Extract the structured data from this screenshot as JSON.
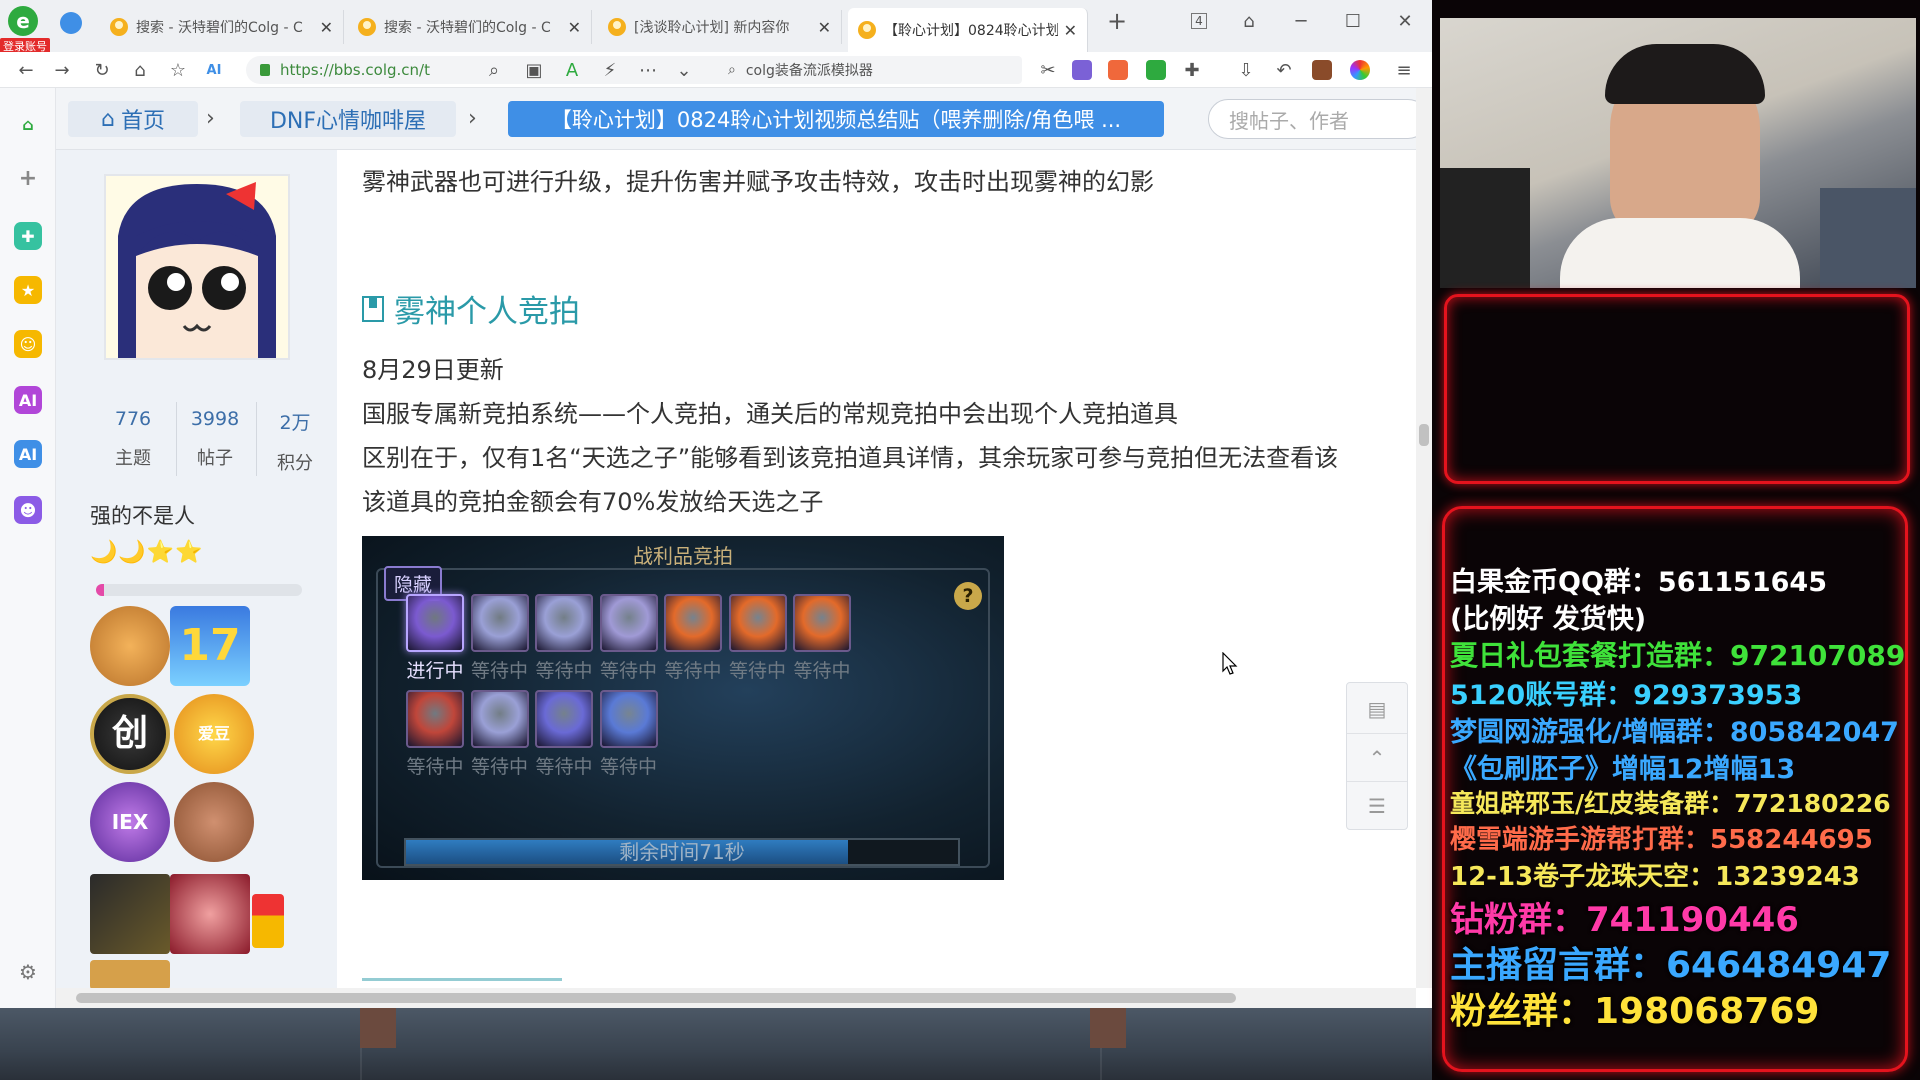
{
  "browser": {
    "login_badge": "登录账号",
    "tabs": [
      {
        "title": "搜索 - 沃特碧们的Colg - C",
        "active": false
      },
      {
        "title": "搜索 - 沃特碧们的Colg - C",
        "active": false
      },
      {
        "title": "[浅谈聆心计划] 新内容你",
        "active": false
      },
      {
        "title": "【聆心计划】0824聆心计划",
        "active": true
      }
    ],
    "new_tab": "+",
    "tab_count": "4",
    "url": "https://bbs.colg.cn/t",
    "search_text": "colg装备流派模拟器"
  },
  "nav": {
    "home": "首页",
    "forum": "DNF心情咖啡屋",
    "thread": "【聆心计划】0824聆心计划视频总结贴（喂养删除/角色喂 ...",
    "search_placeholder": "搜帖子、作者"
  },
  "user": {
    "stats": [
      {
        "num": "776",
        "label": "主题"
      },
      {
        "num": "3998",
        "label": "帖子"
      },
      {
        "num": "2万",
        "label": "积分"
      }
    ],
    "name": "强的不是人",
    "level_icons": "🌙🌙⭐⭐",
    "progress": 0.04,
    "medal_labels": [
      "17",
      "创",
      "IEX",
      "爱豆"
    ]
  },
  "article": {
    "line_top": "雾神武器也可进行升级，提升伤害并赋予攻击特效，攻击时出现雾神的幻影",
    "heading": "雾神个人竞拍",
    "date": "8月29日更新",
    "p1": "国服专属新竞拍系统——个人竞拍，通关后的常规竞拍中会出现个人竞拍道具",
    "p2": "区别在于，仅有1名“天选之子”能够看到该竞拍道具详情，其余玩家可参与竞拍但无法查看该",
    "p3": "该道具的竞拍金额会有70%发放给天选之子"
  },
  "auction": {
    "title": "战利品竞拍",
    "hidden": "隐藏",
    "help": "?",
    "in_progress": "进行中",
    "waiting": "等待中",
    "item_tag": "隐藏",
    "timer": "剩余时间71秒",
    "timer_fraction": 0.8
  },
  "stream": {
    "ads": [
      {
        "text": "白果金币QQ群：561151645",
        "color": "#ffffff"
      },
      {
        "text": "(比例好 发货快)",
        "color": "#ffffff"
      },
      {
        "text": "夏日礼包套餐打造群：972107089",
        "color": "#3fe23a"
      },
      {
        "text": "5120账号群：929373953",
        "color": "#3ad0ff"
      },
      {
        "text": "梦圆网游强化/增幅群：805842047",
        "color": "#3aa8ff"
      },
      {
        "text": "《包刷胚子》增幅12增幅13",
        "color": "#3aa8ff"
      },
      {
        "text": "童姐辟邪玉/红皮装备群：772180226",
        "color": "#f6e85a"
      },
      {
        "text": "樱雪端游手游帮打群：558244695",
        "color": "#ff6b4a"
      },
      {
        "text": "12-13卷子龙珠天空：13239243",
        "color": "#f6e85a"
      },
      {
        "text": "钻粉群：741190446",
        "color": "#ff3aa8"
      },
      {
        "text": "主播留言群：646484947",
        "color": "#3aa8ff"
      },
      {
        "text": "粉丝群：198068769",
        "color": "#ffe23a"
      }
    ]
  }
}
